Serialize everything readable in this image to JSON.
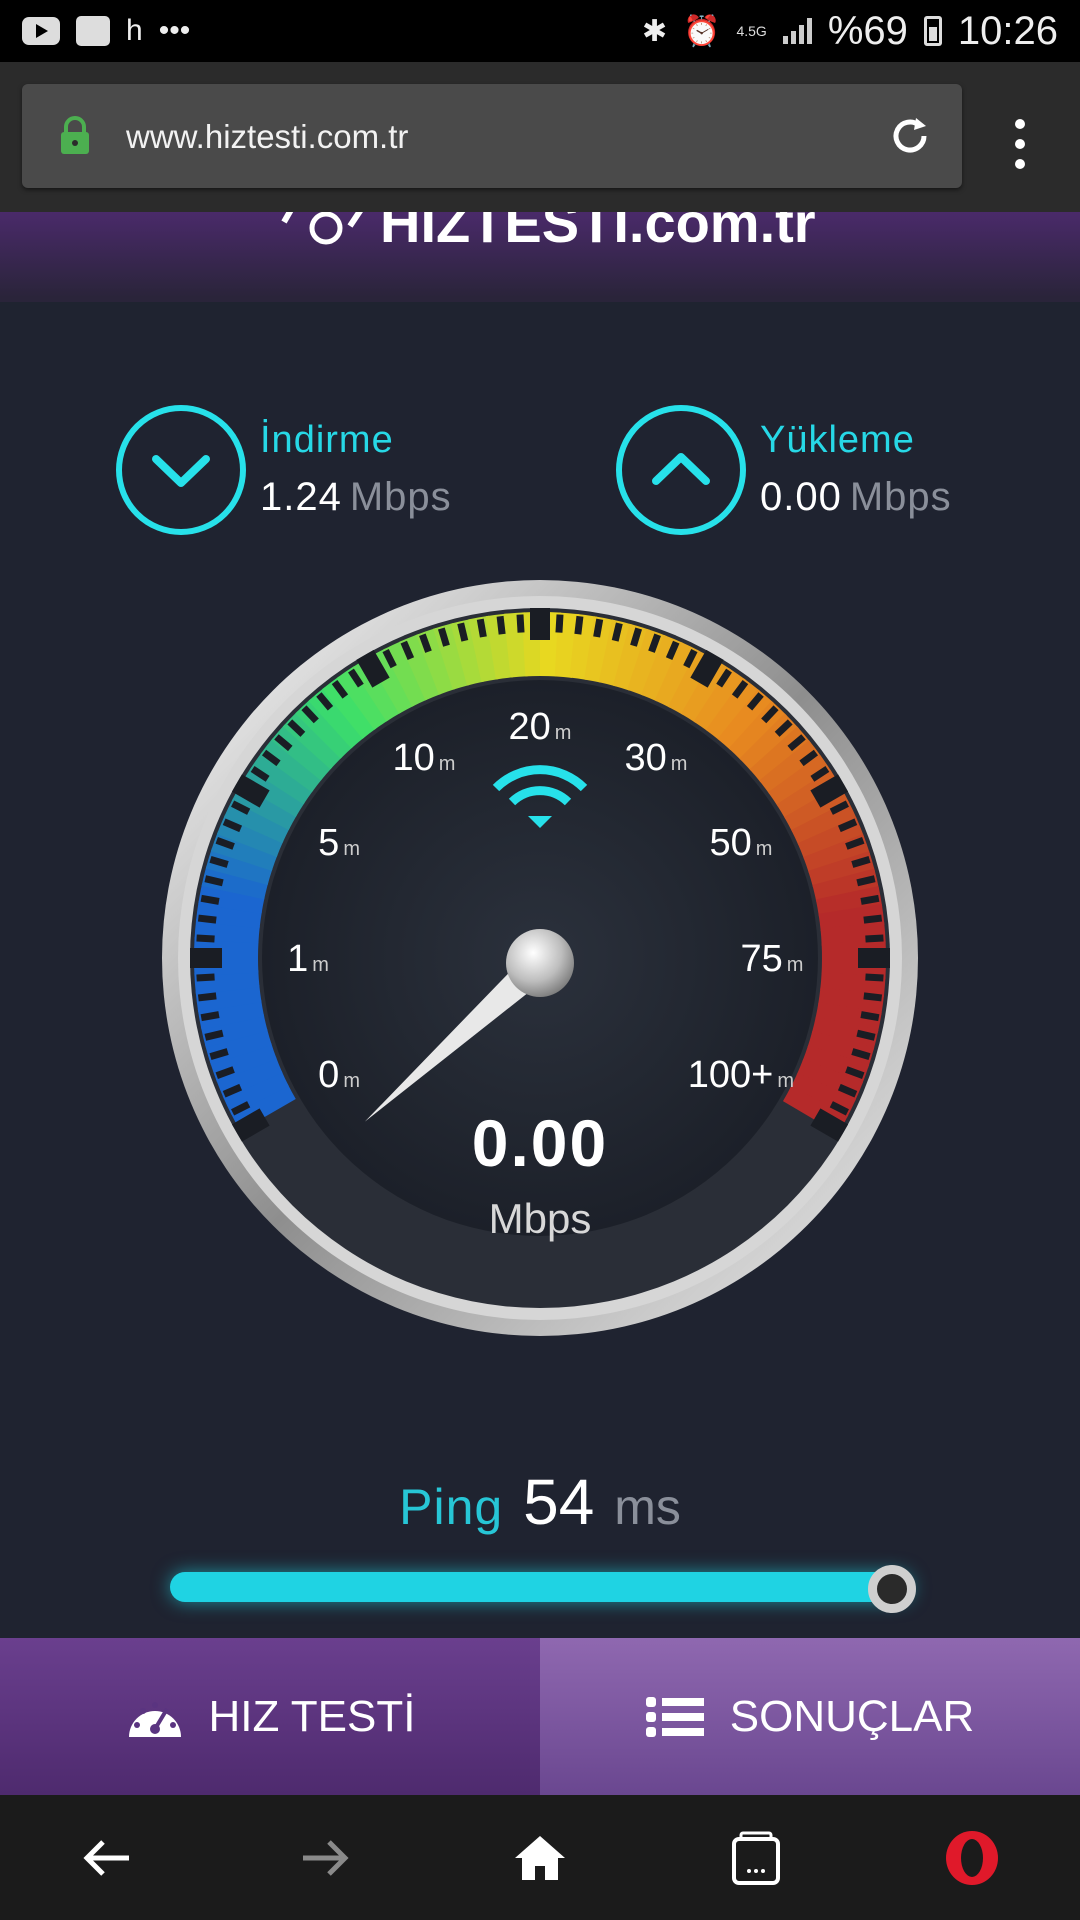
{
  "status_bar": {
    "left_letter": "h",
    "left_more": "•••",
    "network_type": "4.5G",
    "battery": "%69",
    "time": "10:26"
  },
  "browser": {
    "url": "www.hiztesti.com.tr"
  },
  "header": {
    "logo_text": "HIZTESTI.com.tr"
  },
  "download": {
    "label": "İndirme",
    "value": "1.24",
    "unit": "Mbps"
  },
  "upload": {
    "label": "Yükleme",
    "value": "0.00",
    "unit": "Mbps"
  },
  "gauge": {
    "scale_labels": [
      {
        "num": "0",
        "sub": "m"
      },
      {
        "num": "1",
        "sub": "m"
      },
      {
        "num": "5",
        "sub": "m"
      },
      {
        "num": "10",
        "sub": "m"
      },
      {
        "num": "20",
        "sub": "m"
      },
      {
        "num": "30",
        "sub": "m"
      },
      {
        "num": "50",
        "sub": "m"
      },
      {
        "num": "75",
        "sub": "m"
      },
      {
        "num": "100+",
        "sub": "m"
      }
    ],
    "value": "0.00",
    "unit": "Mbps",
    "needle_scale_fraction": 0.03,
    "colors": {
      "track_start": "#1b66d0",
      "mid": "#3ce06a",
      "yellow": "#e8d820",
      "orange": "#e88a20",
      "red": "#b52a2a",
      "accent": "#27e1ea"
    }
  },
  "ping": {
    "label": "Ping",
    "value": "54",
    "unit": "ms",
    "progress": 1.0
  },
  "tabs": [
    {
      "label": "HIZ TESTİ",
      "icon": "speedometer-icon"
    },
    {
      "label": "SONUÇLAR",
      "icon": "list-icon"
    }
  ],
  "nav": {
    "icons": [
      "back-arrow-icon",
      "forward-arrow-icon",
      "home-icon",
      "tabs-icon",
      "opera-icon"
    ]
  }
}
